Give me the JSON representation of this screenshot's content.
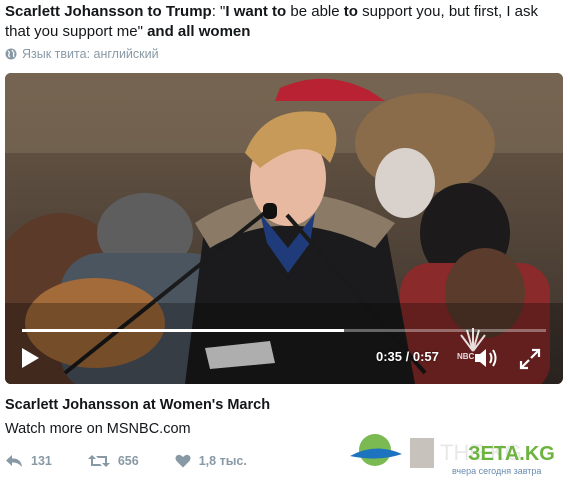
{
  "tweet": {
    "text_bold_1": "Scarlett Johansson to Trump",
    "text_plain_1": ": \"",
    "text_bold_2": "I want to",
    "text_plain_2": " be able ",
    "text_bold_3": "to",
    "text_plain_3": " support you, but first, I ask that you support me\"",
    "text_bold_4": " and all women",
    "language": "Язык твита: английский"
  },
  "video": {
    "current_time": "0:35",
    "duration": "0:57",
    "time_display": "0:35 / 0:57",
    "progress_fraction": 0.614,
    "overlay_logo": "NBC"
  },
  "card": {
    "title": "Scarlett Johansson at Women's March",
    "subtitle": "Watch more on MSNBC.com"
  },
  "actions": {
    "replies": "131",
    "retweets": "656",
    "likes": "1,8 тыс."
  },
  "watermark": {
    "brand": "ЗЕТА.KG",
    "tagline": "вчера сегодня завтра",
    "ghost_text": "THE KG"
  },
  "colors": {
    "text": "#14171a",
    "muted": "#8899a6",
    "progress": "#ffffff",
    "watermark_green": "#6db33f",
    "watermark_blue": "#1e73be"
  },
  "icons": [
    "globe-icon",
    "play-icon",
    "nbc-peacock-icon",
    "volume-icon",
    "fullscreen-icon",
    "reply-icon",
    "retweet-icon",
    "heart-icon"
  ]
}
